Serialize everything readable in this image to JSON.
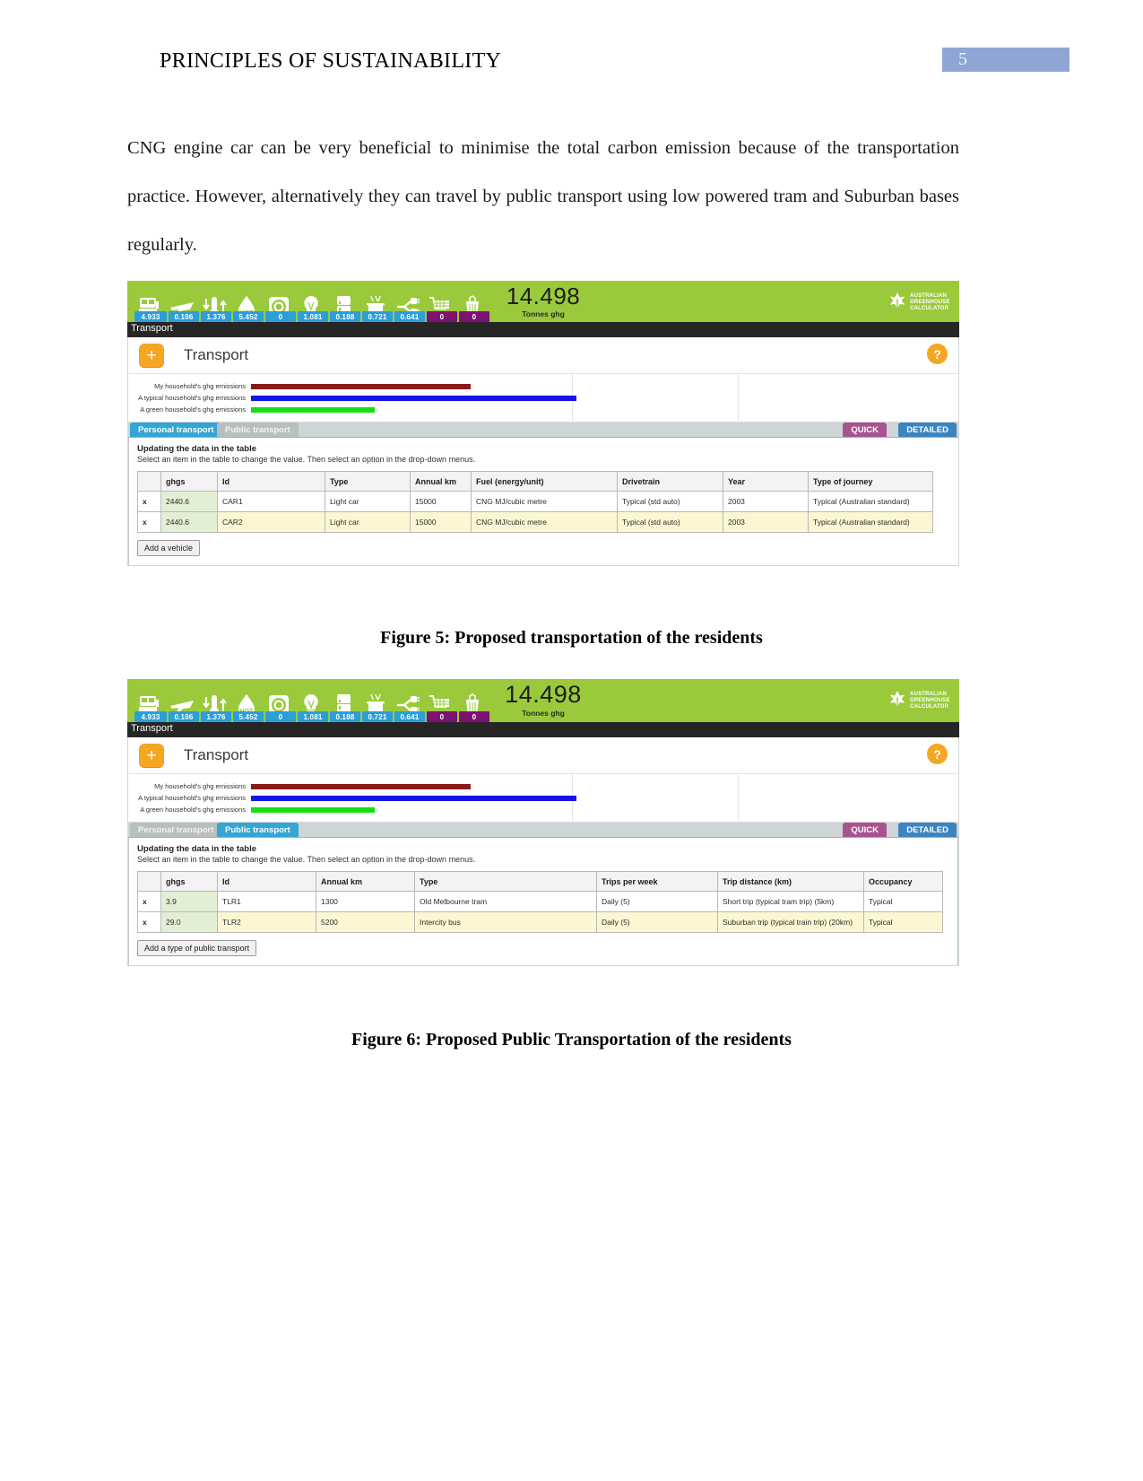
{
  "header": {
    "title": "PRINCIPLES OF SUSTAINABILITY",
    "page_number": "5",
    "page_box_color": "#8fa5d4"
  },
  "paragraph": "CNG engine car can be very beneficial to minimise the total carbon emission because of the transportation practice. However, alternatively they can travel by public transport using low powered tram and Suburban bases regularly.",
  "captions": {
    "figure5": "Figure 5: Proposed transportation of the residents",
    "figure6": "Figure 6: Proposed Public Transportation of the residents"
  },
  "calculator": {
    "brand": {
      "line1": "AUSTRALIAN",
      "line2": "GREENHOUSE",
      "line3": "CALCULATOR"
    },
    "bar_color": "#9aca3c",
    "total_value": "14.498",
    "total_unit": "Tonnes ghg",
    "icons": [
      {
        "name": "car-transport-icon",
        "value": "4.933",
        "chip": "blue"
      },
      {
        "name": "airplane-icon",
        "value": "0.106",
        "chip": "blue"
      },
      {
        "name": "thermometer-heating-cooling-icon",
        "value": "1.376",
        "chip": "blue"
      },
      {
        "name": "hot-water-droplet-icon",
        "value": "5.452",
        "chip": "blue"
      },
      {
        "name": "washing-machine-icon",
        "value": "0",
        "chip": "blue"
      },
      {
        "name": "light-bulb-icon",
        "value": "1.081",
        "chip": "blue"
      },
      {
        "name": "refrigerator-icon",
        "value": "0.188",
        "chip": "blue"
      },
      {
        "name": "cooking-pot-icon",
        "value": "0.721",
        "chip": "blue"
      },
      {
        "name": "appliances-plug-icon",
        "value": "0.641",
        "chip": "blue"
      },
      {
        "name": "shopping-cart-icon",
        "value": "0",
        "chip": "purple"
      },
      {
        "name": "waste-bin-icon",
        "value": "0",
        "chip": "purple"
      }
    ],
    "section_strip_label": "Transport",
    "panel": {
      "add_button": "+",
      "title": "Transport",
      "help_button": "?"
    },
    "comparison_bars": [
      {
        "label": "My household's ghg emissions",
        "color": "#8b1a1a",
        "width_pct": 31
      },
      {
        "label": "A typical household's ghg emissions",
        "color": "#1414e6",
        "width_pct": 45
      },
      {
        "label": "A green household's ghg emissions",
        "color": "#15e015",
        "width_pct": 17
      }
    ],
    "tabs": {
      "personal": "Personal transport",
      "public": "Public transport",
      "quick": "QUICK",
      "detailed": "DETAILED"
    },
    "instructions": {
      "heading": "Updating the data in the table",
      "body": "Select an item in the table to change the value. Then select an option in the drop-down menus."
    }
  },
  "figure5": {
    "active_tab": "Personal transport",
    "table": {
      "headers": [
        "",
        "ghgs",
        "Id",
        "Type",
        "Annual km",
        "Fuel (energy/unit)",
        "Drivetrain",
        "Year",
        "Type of journey"
      ],
      "rows": [
        {
          "remove": "x",
          "cells": [
            "2440.6",
            "CAR1",
            "Light car",
            "15000",
            "CNG  MJ/cubic metre",
            "Typical (std auto)",
            "2003",
            "Typical (Australian standard)"
          ]
        },
        {
          "remove": "x",
          "cells": [
            "2440.6",
            "CAR2",
            "Light car",
            "15000",
            "CNG  MJ/cubic metre",
            "Typical (std auto)",
            "2003",
            "Typical (Australian standard)"
          ]
        }
      ]
    },
    "add_button": "Add a vehicle"
  },
  "figure6": {
    "active_tab": "Public transport",
    "table": {
      "headers": [
        "",
        "ghgs",
        "Id",
        "Annual km",
        "Type",
        "Trips per week",
        "Trip distance (km)",
        "Occupancy"
      ],
      "rows": [
        {
          "remove": "x",
          "cells": [
            "3.9",
            "TLR1",
            "1300",
            "Old Melbourne tram",
            "Daily (5)",
            "Short trip (typical tram trip) (5km)",
            "Typical"
          ]
        },
        {
          "remove": "x",
          "cells": [
            "29.0",
            "TLR2",
            "5200",
            "Intercity bus",
            "Daily (5)",
            "Suburban trip (typical train trip) (20km)",
            "Typical"
          ]
        }
      ]
    },
    "add_button": "Add a type of public transport"
  }
}
